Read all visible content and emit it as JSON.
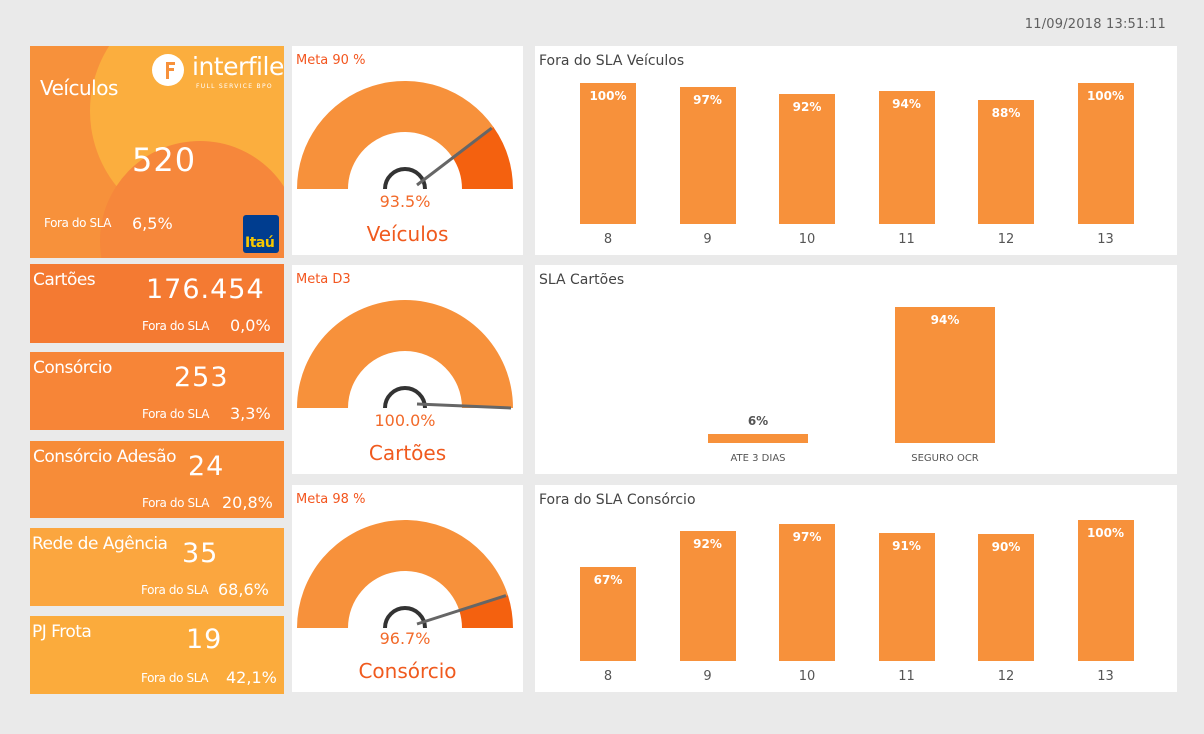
{
  "timestamp": "11/09/2018 13:51:11",
  "brand": {
    "name": "interfile",
    "tagline": "FULL SERVICE BPO",
    "bank": "Itaú"
  },
  "colors": {
    "accent": "#f7913b",
    "dark_orange": "#f05a1e",
    "yellow": "#fbab3c"
  },
  "kpis": [
    {
      "label": "Veículos",
      "value": "520",
      "sla_label": "Fora do SLA",
      "sla_value": "6,5%"
    },
    {
      "label": "Cartões",
      "value": "176.454",
      "sla_label": "Fora do SLA",
      "sla_value": "0,0%"
    },
    {
      "label": "Consórcio",
      "value": "253",
      "sla_label": "Fora do SLA",
      "sla_value": "3,3%"
    },
    {
      "label": "Consórcio Adesão",
      "value": "24",
      "sla_label": "Fora do SLA",
      "sla_value": "20,8%"
    },
    {
      "label": "Rede de Agência",
      "value": "35",
      "sla_label": "Fora do SLA",
      "sla_value": "68,6%"
    },
    {
      "label": "PJ Frota",
      "value": "19",
      "sla_label": "Fora do SLA",
      "sla_value": "42,1%"
    }
  ],
  "gauges": [
    {
      "meta": "Meta 90 %",
      "value_text": "93.5%",
      "value": 93.5,
      "name": "Veículos"
    },
    {
      "meta": "Meta D3",
      "value_text": "100.0%",
      "value": 100.0,
      "name": "Cartões"
    },
    {
      "meta": "Meta 98 %",
      "value_text": "96.7%",
      "value": 96.7,
      "name": "Consórcio"
    }
  ],
  "chart_data": [
    {
      "type": "bar",
      "title": "Fora do SLA Veículos",
      "categories": [
        "8",
        "9",
        "10",
        "11",
        "12",
        "13"
      ],
      "values": [
        100,
        97,
        92,
        94,
        88,
        100
      ],
      "labels": [
        "100%",
        "97%",
        "92%",
        "94%",
        "88%",
        "100%"
      ],
      "ylim": [
        0,
        100
      ]
    },
    {
      "type": "bar",
      "title": "SLA Cartões",
      "categories": [
        "ATE 3 DIAS",
        "SEGURO OCR"
      ],
      "values": [
        6,
        94
      ],
      "labels": [
        "6%",
        "94%"
      ],
      "ylim": [
        0,
        94
      ]
    },
    {
      "type": "bar",
      "title": "Fora do SLA Consórcio",
      "categories": [
        "8",
        "9",
        "10",
        "11",
        "12",
        "13"
      ],
      "values": [
        67,
        92,
        97,
        91,
        90,
        100
      ],
      "labels": [
        "67%",
        "92%",
        "97%",
        "91%",
        "90%",
        "100%"
      ],
      "ylim": [
        0,
        100
      ]
    }
  ]
}
